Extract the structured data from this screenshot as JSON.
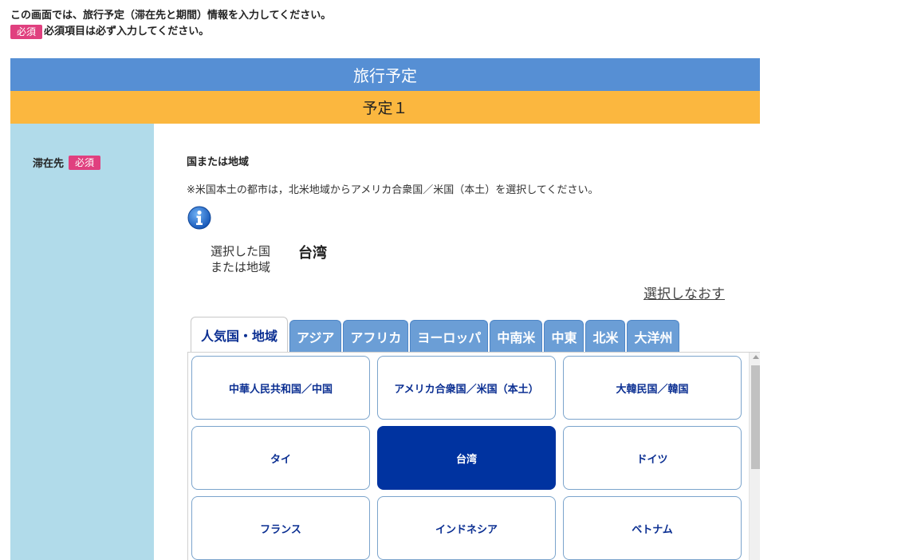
{
  "intro": {
    "line1": "この画面では、旅行予定（滞在先と期間）情報を入力してください。",
    "badge": "必須",
    "line2": "必須項目は必ず入力してください。"
  },
  "header": {
    "title": "旅行予定",
    "subtitle": "予定１"
  },
  "stay": {
    "label": "滞在先",
    "badge": "必須",
    "field_title": "国または地域",
    "note": "※米国本土の都市は，北米地域からアメリカ合衆国／米国（本土）を選択してください。",
    "info_icon": "info-icon",
    "selected_label_line1": "選択した国",
    "selected_label_line2": "または地域",
    "selected_value": "台湾",
    "reselect": "選択しなおす"
  },
  "tabs": [
    {
      "label": "人気国・地域",
      "active": true
    },
    {
      "label": "アジア"
    },
    {
      "label": "アフリカ"
    },
    {
      "label": "ヨーロッパ"
    },
    {
      "label": "中南米"
    },
    {
      "label": "中東"
    },
    {
      "label": "北米"
    },
    {
      "label": "大洋州"
    }
  ],
  "countries": [
    {
      "label": "中華人民共和国／中国"
    },
    {
      "label": "アメリカ合衆国／米国（本土）"
    },
    {
      "label": "大韓民国／韓国"
    },
    {
      "label": "タイ"
    },
    {
      "label": "台湾",
      "selected": true
    },
    {
      "label": "ドイツ"
    },
    {
      "label": "フランス"
    },
    {
      "label": "インドネシア"
    },
    {
      "label": "ベトナム"
    }
  ],
  "colors": {
    "header_blue": "#568fd4",
    "header_orange": "#fbb73f",
    "sidebar": "#b1dbea",
    "required_badge": "#e0407f",
    "selected_country": "#0033a0"
  }
}
